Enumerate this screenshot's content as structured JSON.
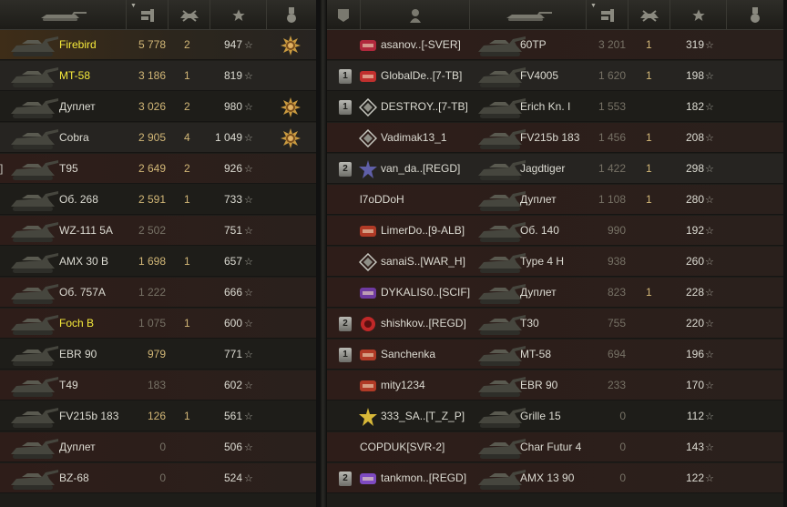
{
  "colors": {
    "gold": "#d2b777",
    "dim": "#777266",
    "highlight": "#f6ea3b",
    "selected_row": "#3e2d18",
    "dead_row": "#2e1d19"
  },
  "left_team": {
    "headers": [
      "tank-icon",
      "damage-icon",
      "kills-icon",
      "xp-star-icon",
      "medal-icon"
    ],
    "rows": [
      {
        "vehicle": "Firebird",
        "damage": "5 778",
        "kills": "2",
        "xp": "947",
        "medal": true,
        "highlight": true,
        "dim_damage": false,
        "bg": "sel"
      },
      {
        "vehicle": "MT-58",
        "damage": "3 186",
        "kills": "1",
        "xp": "819",
        "medal": false,
        "highlight": true,
        "dim_damage": false,
        "bg": "dark"
      },
      {
        "vehicle": "Дуплет",
        "damage": "3 026",
        "kills": "2",
        "xp": "980",
        "medal": true,
        "highlight": false,
        "dim_damage": false,
        "bg": "plain"
      },
      {
        "vehicle": "Cobra",
        "damage": "2 905",
        "kills": "4",
        "xp": "1 049",
        "medal": true,
        "highlight": false,
        "dim_damage": false,
        "bg": "dark"
      },
      {
        "vehicle": "T95",
        "damage": "2 649",
        "kills": "2",
        "xp": "926",
        "medal": false,
        "highlight": false,
        "dim_damage": false,
        "bg": "red",
        "bracket": "]"
      },
      {
        "vehicle": "Об. 268",
        "damage": "2 591",
        "kills": "1",
        "xp": "733",
        "medal": false,
        "highlight": false,
        "dim_damage": false,
        "bg": "plain"
      },
      {
        "vehicle": "WZ-111 5A",
        "damage": "2 502",
        "kills": "",
        "xp": "751",
        "medal": false,
        "highlight": false,
        "dim_damage": true,
        "bg": "red"
      },
      {
        "vehicle": "AMX 30 B",
        "damage": "1 698",
        "kills": "1",
        "xp": "657",
        "medal": false,
        "highlight": false,
        "dim_damage": false,
        "bg": "plain"
      },
      {
        "vehicle": "Об. 757А",
        "damage": "1 222",
        "kills": "",
        "xp": "666",
        "medal": false,
        "highlight": false,
        "dim_damage": true,
        "bg": "red"
      },
      {
        "vehicle": "Foch B",
        "damage": "1 075",
        "kills": "1",
        "xp": "600",
        "medal": false,
        "highlight": true,
        "dim_damage": true,
        "bg": "red"
      },
      {
        "vehicle": "EBR 90",
        "damage": "979",
        "kills": "",
        "xp": "771",
        "medal": false,
        "highlight": false,
        "dim_damage": false,
        "bg": "plain"
      },
      {
        "vehicle": "T49",
        "damage": "183",
        "kills": "",
        "xp": "602",
        "medal": false,
        "highlight": false,
        "dim_damage": true,
        "bg": "red"
      },
      {
        "vehicle": "FV215b 183",
        "damage": "126",
        "kills": "1",
        "xp": "561",
        "medal": false,
        "highlight": false,
        "dim_damage": false,
        "bg": "plain"
      },
      {
        "vehicle": "Дуплет",
        "damage": "0",
        "kills": "",
        "xp": "506",
        "medal": false,
        "highlight": false,
        "dim_damage": true,
        "bg": "red"
      },
      {
        "vehicle": "BZ-68",
        "damage": "0",
        "kills": "",
        "xp": "524",
        "medal": false,
        "highlight": false,
        "dim_damage": true,
        "bg": "red"
      }
    ]
  },
  "right_team": {
    "headers": [
      "platoon-icon",
      "player-icon",
      "tank-icon",
      "damage-icon",
      "kills-icon",
      "xp-star-icon",
      "medal-icon"
    ],
    "rows": [
      {
        "platoon": "",
        "clan_icon": "jove-emblem",
        "player": "asanov..[-SVER]",
        "vehicle": "60TP",
        "damage": "3 201",
        "kills": "1",
        "xp": "319",
        "bg": "red"
      },
      {
        "platoon": "1",
        "clan_icon": "legion-emblem",
        "player": "GlobalDe..[7-TB]",
        "vehicle": "FV4005",
        "damage": "1 620",
        "kills": "1",
        "xp": "198",
        "bg": "dark"
      },
      {
        "platoon": "1",
        "clan_icon": "diamond-emblem",
        "player": "DESTROY..[7-TB]",
        "vehicle": "Erich Kn. I",
        "damage": "1 553",
        "kills": "",
        "xp": "182",
        "bg": "plain"
      },
      {
        "platoon": "",
        "clan_icon": "diamond-emblem",
        "player": "Vadimak13_1",
        "vehicle": "FV215b 183",
        "damage": "1 456",
        "kills": "1",
        "xp": "208",
        "bg": "red"
      },
      {
        "platoon": "2",
        "clan_icon": "star-emblem",
        "player": "van_da..[REGD]",
        "vehicle": "Jagdtiger",
        "damage": "1 422",
        "kills": "1",
        "xp": "298",
        "bg": "dark"
      },
      {
        "platoon": "",
        "clan_icon": "",
        "player": "l7oDDoH",
        "vehicle": "Дуплет",
        "damage": "1 108",
        "kills": "1",
        "xp": "280",
        "bg": "red"
      },
      {
        "platoon": "",
        "clan_icon": "ribbon-emblem",
        "player": "LimerDo..[9-ALB]",
        "vehicle": "Об. 140",
        "damage": "990",
        "kills": "",
        "xp": "192",
        "bg": "red"
      },
      {
        "platoon": "",
        "clan_icon": "diamond-emblem",
        "player": "sanaiS..[WAR_H]",
        "vehicle": "Type 4 H",
        "damage": "938",
        "kills": "",
        "xp": "260",
        "bg": "red"
      },
      {
        "platoon": "",
        "clan_icon": "bolt-emblem",
        "player": "DYKALIS0..[SCIF]",
        "vehicle": "Дуплет",
        "damage": "823",
        "kills": "1",
        "xp": "228",
        "bg": "red"
      },
      {
        "platoon": "2",
        "clan_icon": "red-disc-emblem",
        "player": "shishkov..[REGD]",
        "vehicle": "T30",
        "damage": "755",
        "kills": "",
        "xp": "220",
        "bg": "red"
      },
      {
        "platoon": "1",
        "clan_icon": "ribbon-emblem",
        "player": "Sanchenka",
        "vehicle": "MT-58",
        "damage": "694",
        "kills": "",
        "xp": "196",
        "bg": "red"
      },
      {
        "platoon": "",
        "clan_icon": "ribbon-emblem",
        "player": "mity1234",
        "vehicle": "EBR 90",
        "damage": "233",
        "kills": "",
        "xp": "170",
        "bg": "red"
      },
      {
        "platoon": "",
        "clan_icon": "star-burst-emblem",
        "player": "333_SA..[T_Z_P]",
        "vehicle": "Grille 15",
        "damage": "0",
        "kills": "",
        "xp": "112",
        "bg": "plain"
      },
      {
        "platoon": "",
        "clan_icon": "",
        "player": "COPDUK[SVR-2]",
        "vehicle": "Char Futur 4",
        "damage": "0",
        "kills": "",
        "xp": "143",
        "bg": "red"
      },
      {
        "platoon": "2",
        "clan_icon": "jet-emblem",
        "player": "tankmon..[REGD]",
        "vehicle": "AMX 13 90",
        "damage": "0",
        "kills": "",
        "xp": "122",
        "bg": "red"
      }
    ]
  }
}
